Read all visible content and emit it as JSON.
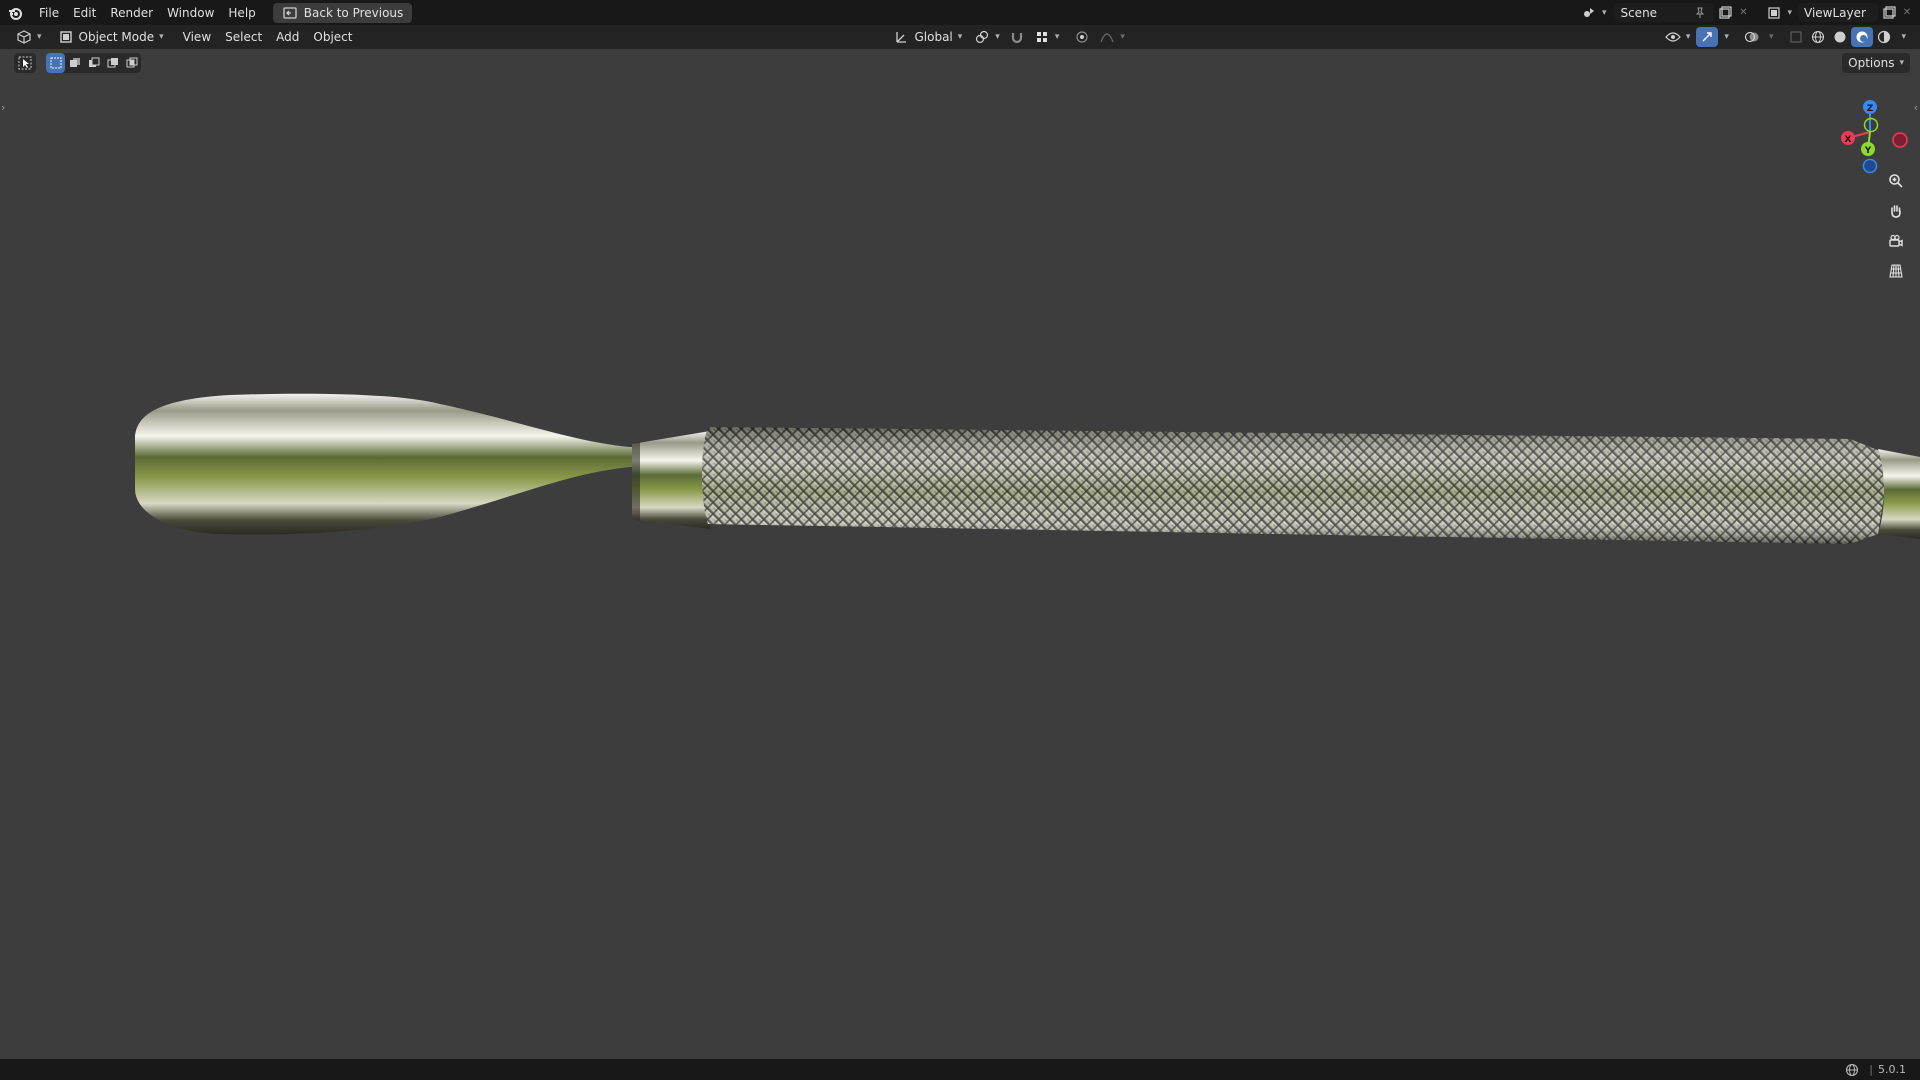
{
  "topbar": {
    "menus": [
      "File",
      "Edit",
      "Render",
      "Window",
      "Help"
    ],
    "back_button": "Back to Previous",
    "scene": "Scene",
    "view_layer": "ViewLayer"
  },
  "header": {
    "mode": "Object Mode",
    "menus": [
      "View",
      "Select",
      "Add",
      "Object"
    ],
    "transform_orientation": "Global",
    "options": "Options"
  },
  "gizmo": {
    "z": "Z",
    "x": "X",
    "y": "Y"
  },
  "status": {
    "version": "5.0.1"
  },
  "colors": {
    "axis_x": "#ee3b54",
    "axis_y": "#8bdc2b",
    "axis_z": "#3a88f6",
    "accent": "#4772b3"
  }
}
